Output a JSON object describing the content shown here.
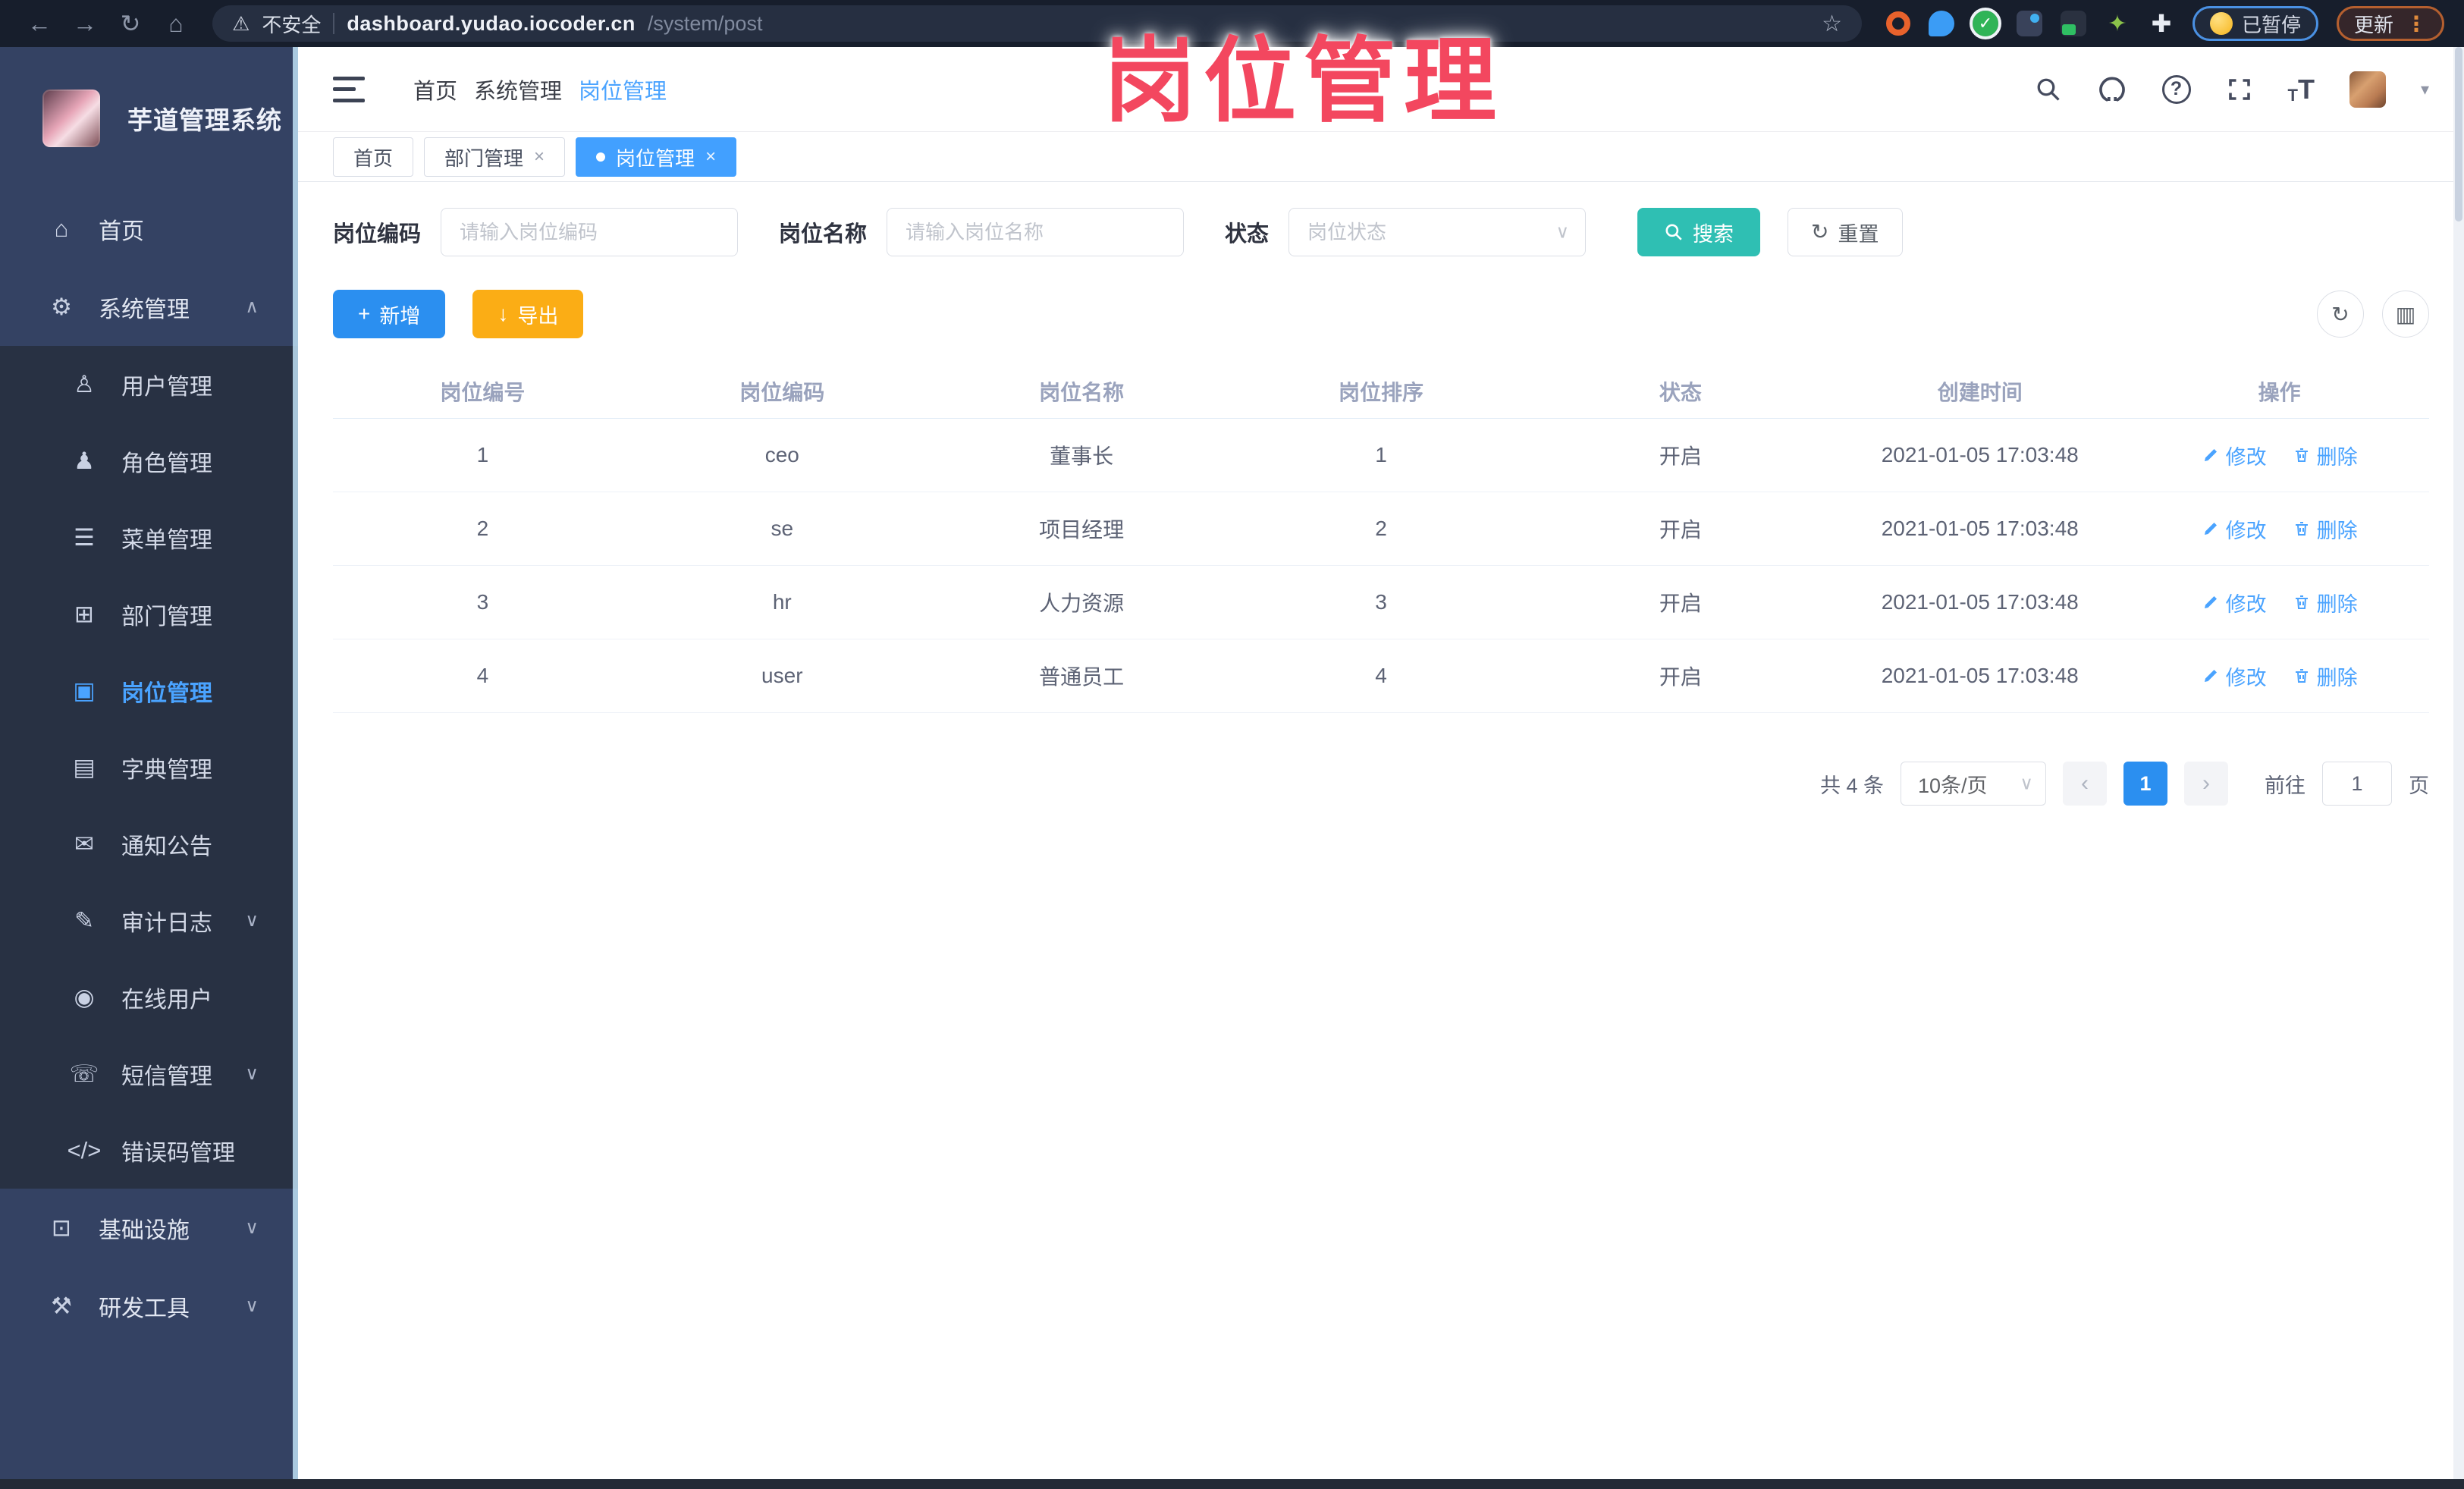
{
  "colors": {
    "accent_blue": "#2b8ff0",
    "link_blue": "#4aa3ff",
    "teal": "#2fbfb3",
    "orange": "#fbad15",
    "overlay_pink": "#f3475f",
    "sidebar_bg": "#344263",
    "submenu_bg": "#283143",
    "chrome_bg": "#171e2c"
  },
  "icons": {
    "back": "←",
    "forward": "→",
    "reload": "↻",
    "home": "⌂",
    "warning": "⚠",
    "star": "☆",
    "check": "✓",
    "sprout": "✦",
    "puzzle": "✚",
    "dots": "⋮",
    "caret": "▾",
    "question": "?",
    "chevron_down": "∨",
    "chevron_up": "∧",
    "plus": "+",
    "download": "↓",
    "refresh": "↻",
    "columns": "▥",
    "prev": "‹",
    "next": "›"
  },
  "browser": {
    "security_label": "不安全",
    "url_host": "dashboard.yudao.iocoder.cn",
    "url_path": "/system/post",
    "paused_badge": "已暂停",
    "update_button": "更新"
  },
  "overlay_title": "岗位管理",
  "sidebar": {
    "app_title": "芋道管理系统",
    "items": [
      {
        "name": "home",
        "label": "首页",
        "icon": "⌂",
        "level": 1
      },
      {
        "name": "system",
        "label": "系统管理",
        "icon": "⚙",
        "level": 1,
        "chevron": "∧"
      },
      {
        "name": "user-mgmt",
        "label": "用户管理",
        "icon": "♙",
        "level": 2
      },
      {
        "name": "role-mgmt",
        "label": "角色管理",
        "icon": "♟",
        "level": 2
      },
      {
        "name": "menu-mgmt",
        "label": "菜单管理",
        "icon": "☰",
        "level": 2
      },
      {
        "name": "dept-mgmt",
        "label": "部门管理",
        "icon": "⊞",
        "level": 2
      },
      {
        "name": "post-mgmt",
        "label": "岗位管理",
        "icon": "▣",
        "level": 2,
        "active": true
      },
      {
        "name": "dict-mgmt",
        "label": "字典管理",
        "icon": "▤",
        "level": 2
      },
      {
        "name": "notice",
        "label": "通知公告",
        "icon": "✉",
        "level": 2
      },
      {
        "name": "audit-log",
        "label": "审计日志",
        "icon": "✎",
        "level": 2,
        "chevron": "∨"
      },
      {
        "name": "online-users",
        "label": "在线用户",
        "icon": "◉",
        "level": 2
      },
      {
        "name": "sms-mgmt",
        "label": "短信管理",
        "icon": "☏",
        "level": 2,
        "chevron": "∨"
      },
      {
        "name": "errcode-mgmt",
        "label": "错误码管理",
        "icon": "</>",
        "level": 2
      },
      {
        "name": "infrastructure",
        "label": "基础设施",
        "icon": "⊡",
        "level": 1,
        "chevron": "∨"
      },
      {
        "name": "dev-tools",
        "label": "研发工具",
        "icon": "⚒",
        "level": 1,
        "chevron": "∨"
      }
    ]
  },
  "header": {
    "breadcrumb": [
      {
        "label": "首页"
      },
      {
        "label": "系统管理"
      },
      {
        "label": "岗位管理",
        "active": true
      }
    ]
  },
  "tabs": [
    {
      "label": "首页"
    },
    {
      "label": "部门管理",
      "close": "×"
    },
    {
      "label": "岗位管理",
      "close": "×",
      "active": true,
      "dot": true
    }
  ],
  "filters": {
    "post_code_label": "岗位编码",
    "post_code_placeholder": "请输入岗位编码",
    "post_name_label": "岗位名称",
    "post_name_placeholder": "请输入岗位名称",
    "status_label": "状态",
    "status_placeholder": "岗位状态",
    "search_button": "搜索",
    "reset_button": "重置"
  },
  "toolbar": {
    "add_button": "新增",
    "export_button": "导出"
  },
  "table": {
    "columns": [
      "岗位编号",
      "岗位编码",
      "岗位名称",
      "岗位排序",
      "状态",
      "创建时间",
      "操作"
    ],
    "edit_label": "修改",
    "delete_label": "删除",
    "rows": [
      {
        "id": "1",
        "code": "ceo",
        "name": "董事长",
        "sort": "1",
        "status": "开启",
        "created": "2021-01-05 17:03:48"
      },
      {
        "id": "2",
        "code": "se",
        "name": "项目经理",
        "sort": "2",
        "status": "开启",
        "created": "2021-01-05 17:03:48"
      },
      {
        "id": "3",
        "code": "hr",
        "name": "人力资源",
        "sort": "3",
        "status": "开启",
        "created": "2021-01-05 17:03:48"
      },
      {
        "id": "4",
        "code": "user",
        "name": "普通员工",
        "sort": "4",
        "status": "开启",
        "created": "2021-01-05 17:03:48"
      }
    ]
  },
  "pagination": {
    "total_text": "共 4 条",
    "page_size": "10条/页",
    "current_page": "1",
    "goto_label": "前往",
    "goto_value": "1",
    "page_unit": "页"
  }
}
